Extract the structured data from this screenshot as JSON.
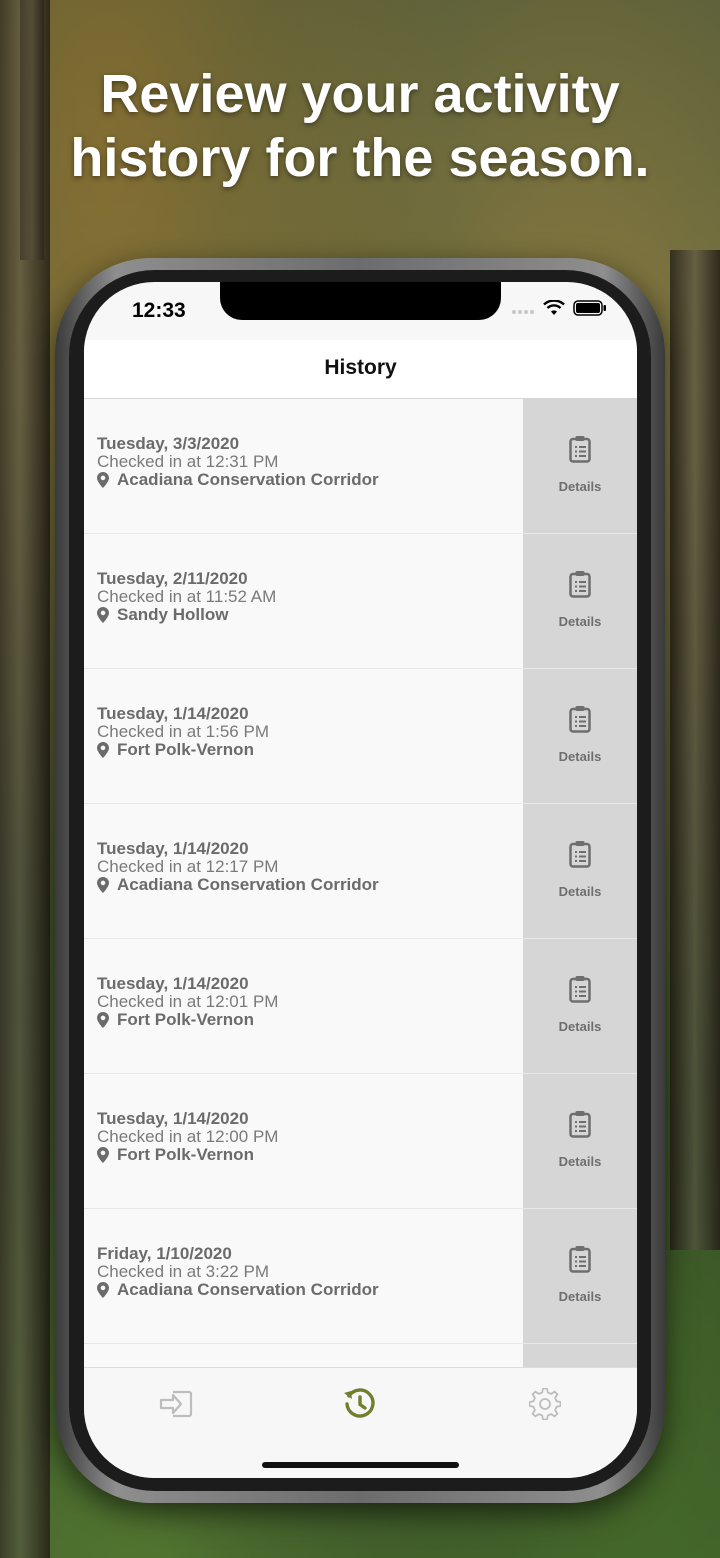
{
  "headline": {
    "line1": "Review your activity",
    "line2": "history for the season."
  },
  "status_bar": {
    "time": "12:33"
  },
  "nav": {
    "title": "History"
  },
  "history": [
    {
      "date": "Tuesday, 3/3/2020",
      "checkin": "Checked in at 12:31 PM",
      "location": "Acadiana Conservation Corridor",
      "action": "Details"
    },
    {
      "date": "Tuesday, 2/11/2020",
      "checkin": "Checked in at 11:52 AM",
      "location": "Sandy Hollow",
      "action": "Details"
    },
    {
      "date": "Tuesday, 1/14/2020",
      "checkin": "Checked in at 1:56 PM",
      "location": "Fort Polk-Vernon",
      "action": "Details"
    },
    {
      "date": "Tuesday, 1/14/2020",
      "checkin": "Checked in at 12:17 PM",
      "location": "Acadiana Conservation Corridor",
      "action": "Details"
    },
    {
      "date": "Tuesday, 1/14/2020",
      "checkin": "Checked in at 12:01 PM",
      "location": "Fort Polk-Vernon",
      "action": "Details"
    },
    {
      "date": "Tuesday, 1/14/2020",
      "checkin": "Checked in at 12:00 PM",
      "location": "Fort Polk-Vernon",
      "action": "Details"
    },
    {
      "date": "Friday, 1/10/2020",
      "checkin": "Checked in at 3:22 PM",
      "location": "Acadiana Conservation Corridor",
      "action": "Details"
    }
  ],
  "tabs": [
    {
      "icon": "check-in-icon",
      "active": false
    },
    {
      "icon": "history-icon",
      "active": true
    },
    {
      "icon": "gear-icon",
      "active": false
    }
  ],
  "colors": {
    "accent": "#6f7f2e",
    "inactive_icon": "#bdbdbd",
    "details_bg": "#d6d6d6"
  }
}
